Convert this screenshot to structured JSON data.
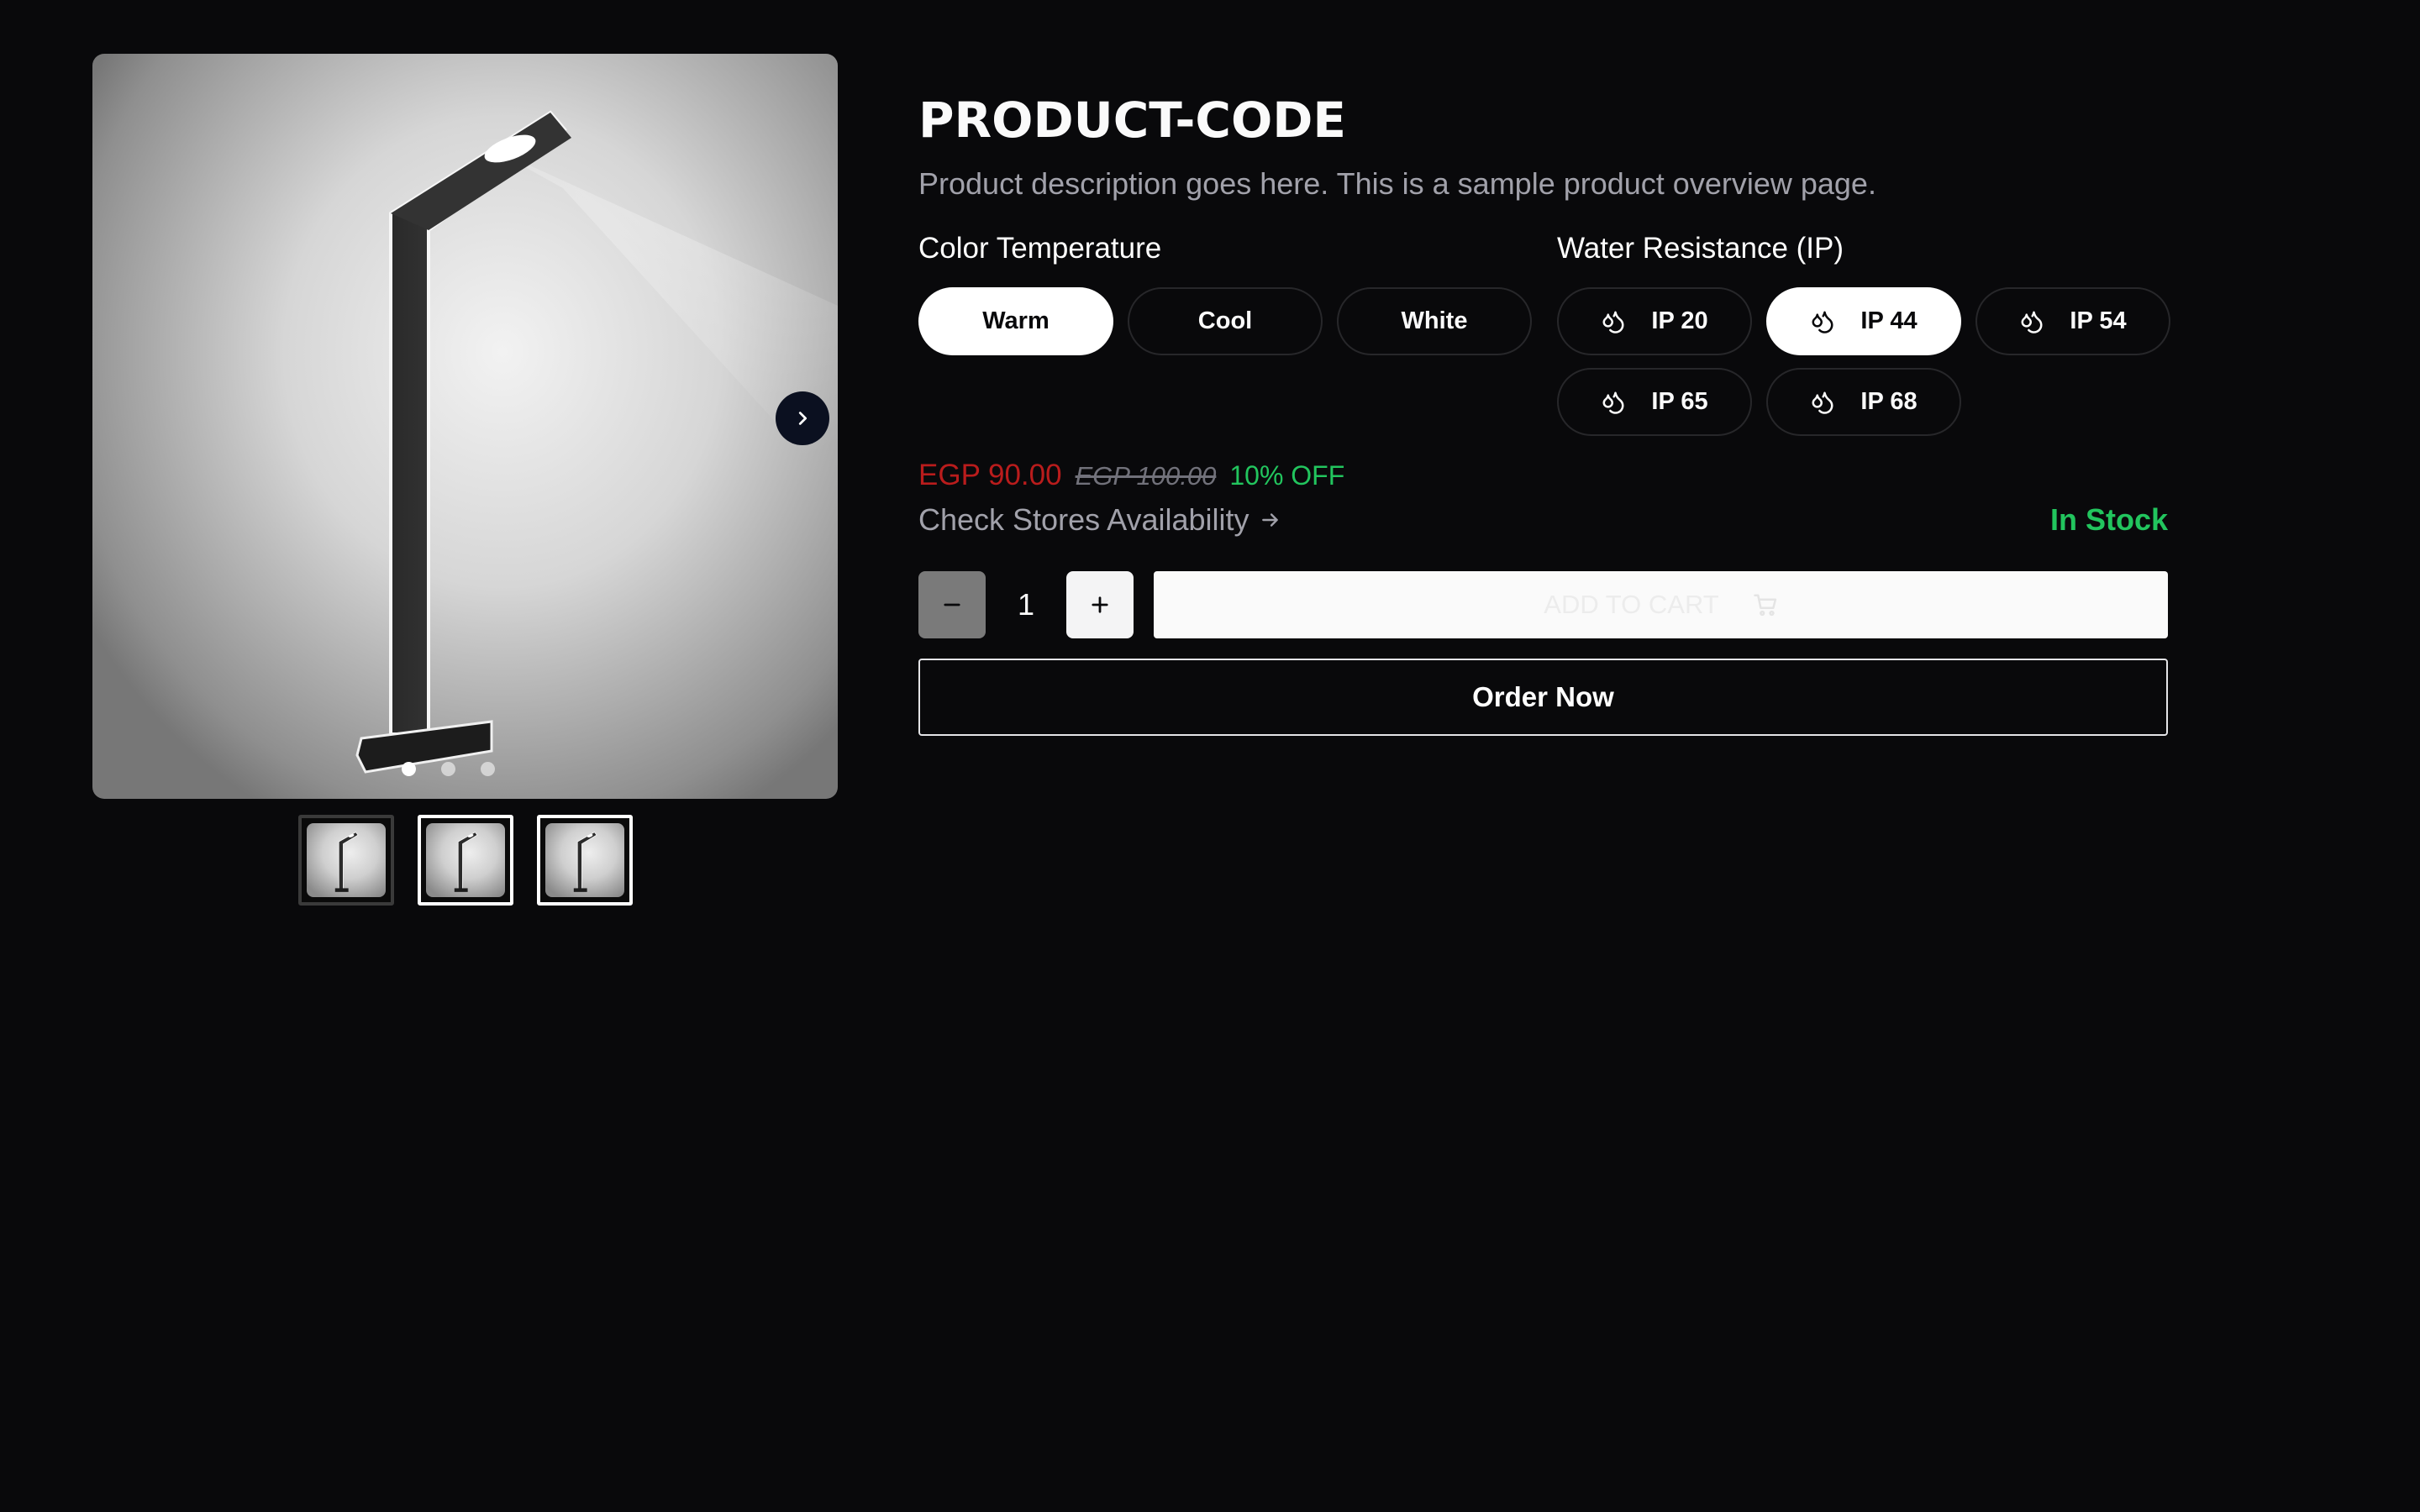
{
  "product": {
    "code": "PRODUCT-CODE",
    "description": "Product description goes here. This is a sample product overview page."
  },
  "gallery": {
    "image_count": 3,
    "active_index": 0,
    "selected_thumbnail": 0,
    "next_icon": "chevron-right-icon"
  },
  "color_temperature": {
    "label": "Color Temperature",
    "options": [
      "Warm",
      "Cool",
      "White"
    ],
    "selected": "Warm"
  },
  "water_resistance": {
    "label": "Water Resistance (IP)",
    "options": [
      "IP 20",
      "IP 44",
      "IP 54",
      "IP 65",
      "IP 68"
    ],
    "selected": "IP 44",
    "icon": "water-drops-icon"
  },
  "pricing": {
    "current": "EGP 90.00",
    "original": "EGP 100.00",
    "discount": "10% OFF",
    "colors": {
      "current": "#b91c1c",
      "discount": "#22c55e"
    }
  },
  "availability": {
    "check_stores": "Check Stores Availability",
    "check_stores_icon": "arrow-right-icon",
    "stock_status": "In Stock",
    "stock_color": "#22c55e"
  },
  "cart": {
    "minus_icon": "minus-icon",
    "plus_icon": "plus-icon",
    "quantity": "1",
    "add_to_cart_label": "ADD TO CART",
    "cart_icon": "shopping-cart-icon"
  },
  "order_now_label": "Order Now"
}
